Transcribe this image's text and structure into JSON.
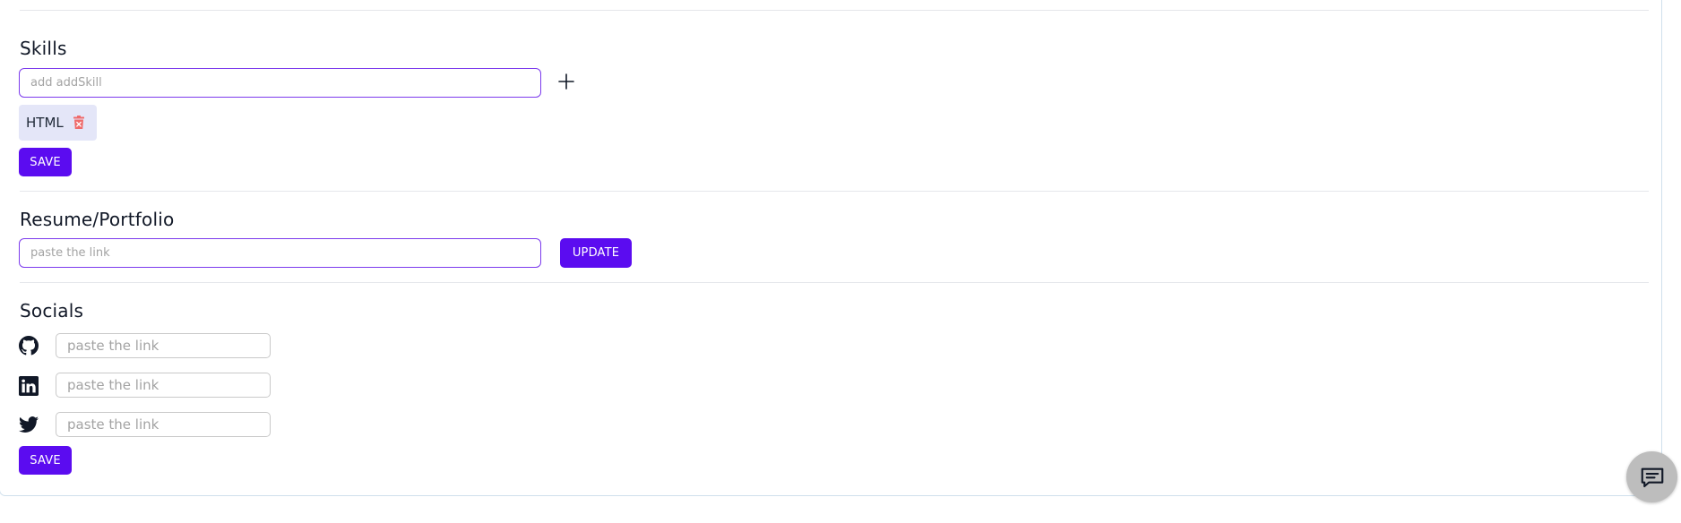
{
  "skills": {
    "heading": "Skills",
    "input_placeholder": "add addSkill",
    "add_icon": "plus-icon",
    "chips": [
      {
        "label": "HTML",
        "remove_icon": "trash-icon"
      }
    ],
    "save_label": "SAVE"
  },
  "resume": {
    "heading": "Resume/Portfolio",
    "input_placeholder": "paste the link",
    "update_label": "UPDATE"
  },
  "socials": {
    "heading": "Socials",
    "items": [
      {
        "icon": "github-icon",
        "placeholder": "paste the link"
      },
      {
        "icon": "linkedin-icon",
        "placeholder": "paste the link"
      },
      {
        "icon": "twitter-icon",
        "placeholder": "paste the link"
      }
    ],
    "save_label": "SAVE"
  },
  "feedback": {
    "icon": "chat-feedback-icon"
  },
  "colors": {
    "accent": "#5b0cf0",
    "input_focus_border": "#7c3aed",
    "chip_bg": "#e4e6f8",
    "trash": "#ef6b6b",
    "fab_bg": "#bdbdbd"
  }
}
